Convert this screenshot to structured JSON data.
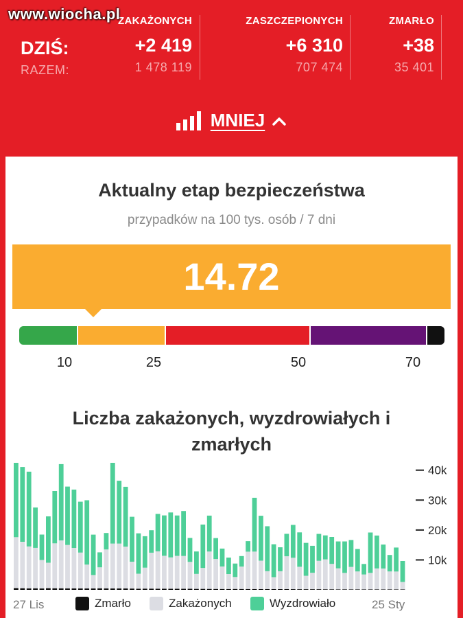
{
  "watermark": "www.wiocha.pl",
  "stats": {
    "today_label": "DZIŚ:",
    "total_label": "RAZEM:",
    "columns": [
      {
        "header": "ZAKAŻONYCH",
        "today": "+2 419",
        "total": "1 478 119"
      },
      {
        "header": "ZASZCZEPIONYCH",
        "today": "+6 310",
        "total": "707 474"
      },
      {
        "header": "ZMARŁO",
        "today": "+38",
        "total": "35 401"
      }
    ]
  },
  "toggle": {
    "label": "MNIEJ",
    "icon": "bar-chart-icon",
    "chevron": "chevron-up-icon"
  },
  "safety": {
    "title": "Aktualny etap bezpieczeństwa",
    "subtitle": "przypadków na 100 tys. osób / 7 dni",
    "value": "14.72",
    "value_color": "#faac30",
    "scale_segments": [
      {
        "from": 0,
        "to": 10,
        "color": "#35a74a"
      },
      {
        "from": 10,
        "to": 25,
        "color": "#faac30"
      },
      {
        "from": 25,
        "to": 50,
        "color": "#e41e26"
      },
      {
        "from": 50,
        "to": 70,
        "color": "#651375"
      },
      {
        "from": 70,
        "to": 73,
        "color": "#111111"
      }
    ],
    "ticks": [
      "10",
      "25",
      "50",
      "70"
    ]
  },
  "chart": {
    "title_line1": "Liczba zakażonych, wyzdrowiałych i",
    "title_line2": "zmarłych",
    "start_label": "27 Lis",
    "end_label": "25 Sty",
    "legend": [
      {
        "label": "Zmarło",
        "color": "#111111"
      },
      {
        "label": "Zakażonych",
        "color": "#dcdde3"
      },
      {
        "label": "Wyzdrowiało",
        "color": "#4ecf98"
      }
    ]
  },
  "chart_data": {
    "type": "bar",
    "stacked": true,
    "x_start": "27 Lis",
    "x_end": "25 Sty",
    "y_ticks": [
      "10k",
      "20k",
      "30k",
      "40k"
    ],
    "ylim": [
      0,
      42000
    ],
    "series": [
      {
        "name": "Zmarło",
        "values": [
          600,
          550,
          500,
          520,
          480,
          560,
          540,
          520,
          510,
          500,
          480,
          460,
          450,
          520,
          500,
          480,
          460,
          450,
          430,
          400,
          420,
          410,
          390,
          380,
          370,
          360,
          350,
          340,
          330,
          320,
          310,
          300,
          290,
          280,
          300,
          290,
          280,
          270,
          260,
          250,
          250,
          240,
          230,
          220,
          210,
          200,
          210,
          200,
          190,
          180,
          170,
          180,
          170,
          160,
          150,
          160,
          150,
          140,
          150,
          140,
          130
        ]
      },
      {
        "name": "Zakażonych",
        "values": [
          17000,
          15500,
          14000,
          13500,
          9500,
          8500,
          15000,
          16000,
          14500,
          13500,
          12000,
          8000,
          4500,
          7000,
          13000,
          15000,
          15000,
          14000,
          9000,
          5000,
          7000,
          12000,
          12500,
          11000,
          10500,
          11000,
          11000,
          9000,
          5000,
          7000,
          12500,
          10000,
          7500,
          5000,
          4000,
          7500,
          12500,
          12500,
          9500,
          6000,
          4000,
          6000,
          11000,
          10500,
          7500,
          4500,
          5500,
          9500,
          10000,
          8500,
          7000,
          5500,
          7500,
          6000,
          5000,
          5500,
          7000,
          7000,
          6000,
          6000,
          2500
        ]
      },
      {
        "name": "Wyzdrowiało",
        "values": [
          25000,
          25000,
          25000,
          13500,
          8500,
          15500,
          17500,
          25500,
          19500,
          19500,
          17000,
          21500,
          13500,
          5000,
          5500,
          31000,
          21000,
          20000,
          15000,
          13500,
          10500,
          7500,
          12500,
          13500,
          15000,
          13500,
          15000,
          8000,
          7500,
          14500,
          12000,
          7000,
          6000,
          5500,
          4500,
          3500,
          3500,
          18000,
          15000,
          15000,
          11000,
          8000,
          7500,
          11000,
          11500,
          11000,
          9000,
          9000,
          8000,
          9000,
          9000,
          10500,
          9000,
          7500,
          3500,
          13500,
          11000,
          8000,
          5500,
          8000,
          7000
        ]
      }
    ]
  }
}
